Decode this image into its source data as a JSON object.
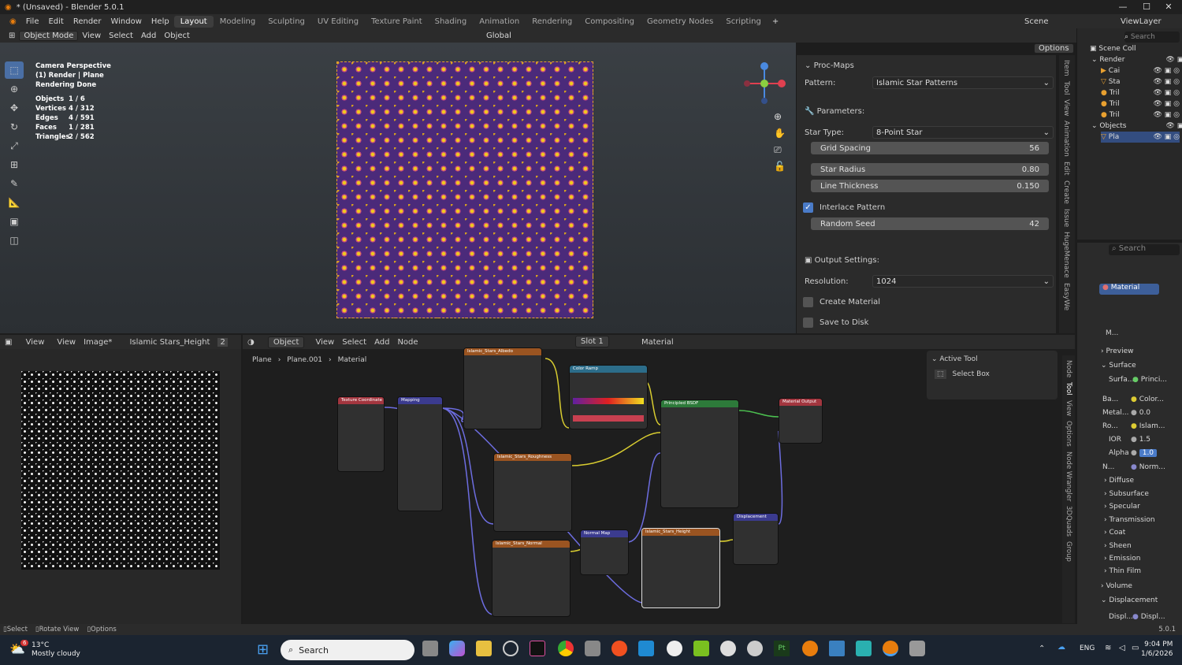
{
  "window": {
    "title": "* (Unsaved) - Blender 5.0.1",
    "min": "—",
    "max": "☐",
    "close": "✕"
  },
  "menu": {
    "items": [
      "File",
      "Edit",
      "Render",
      "Window",
      "Help"
    ],
    "workspaces": [
      "Layout",
      "Modeling",
      "Sculpting",
      "UV Editing",
      "Texture Paint",
      "Shading",
      "Animation",
      "Rendering",
      "Compositing",
      "Geometry Nodes",
      "Scripting"
    ],
    "active": "Layout",
    "add": "+",
    "scene": "Scene",
    "viewlayer": "ViewLayer"
  },
  "viewport_header": {
    "mode": "Object Mode",
    "view": "View",
    "select": "Select",
    "add": "Add",
    "object": "Object",
    "transform": "Global",
    "options": "Options"
  },
  "viewport_info": {
    "line1": "Camera Perspective",
    "line2": "(1) Render | Plane",
    "line3": "Rendering Done",
    "stats": [
      {
        "k": "Objects",
        "v": "1 / 6"
      },
      {
        "k": "Vertices",
        "v": "4 / 312"
      },
      {
        "k": "Edges",
        "v": "4 / 591"
      },
      {
        "k": "Faces",
        "v": "1 / 281"
      },
      {
        "k": "Triangles",
        "v": "2 / 562"
      }
    ]
  },
  "npanel": {
    "title": "Proc-Maps",
    "pattern_label": "Pattern:",
    "pattern": "Islamic Star Patterns",
    "params": "Parameters:",
    "star_type_label": "Star Type:",
    "star_type": "8-Point Star",
    "grid_spacing_label": "Grid Spacing",
    "grid_spacing": "56",
    "star_radius_label": "Star Radius",
    "star_radius": "0.80",
    "line_thickness_label": "Line Thickness",
    "line_thickness": "0.150",
    "interlace": "Interlace Pattern",
    "random_seed_label": "Random Seed",
    "random_seed": "42",
    "output": "Output Settings:",
    "resolution_label": "Resolution:",
    "resolution": "1024",
    "create_material": "Create Material",
    "save_disk": "Save to Disk"
  },
  "side_tabs": [
    "Item",
    "Tool",
    "View",
    "Animation",
    "Edit",
    "Create",
    "Issue",
    "HugeMenace",
    "EasyWe"
  ],
  "outliner": {
    "search": "Search",
    "rows": [
      "Scene Coll",
      "Render",
      "Cai",
      "Sta",
      "Tril",
      "Tril",
      "Tril",
      "Objects",
      "Pla"
    ]
  },
  "properties": {
    "search": "Search",
    "material": "Material",
    "mat_short": "M...",
    "preview": "Preview",
    "surface": "Surface",
    "surface_label": "Surfa...",
    "surface_val": "Princi...",
    "base_label": "Ba...",
    "base_val": "Color...",
    "metal_label": "Metal...",
    "metal_val": "0.0",
    "rough_label": "Ro...",
    "rough_val": "Islam...",
    "ior_label": "IOR",
    "ior_val": "1.5",
    "alpha_label": "Alpha",
    "alpha_val": "1.0",
    "normal_label": "N...",
    "normal_val": "Norm...",
    "sections": [
      "Diffuse",
      "Subsurface",
      "Specular",
      "Transmission",
      "Coat",
      "Sheen",
      "Emission",
      "Thin Film"
    ],
    "volume": "Volume",
    "displacement": "Displacement",
    "disp_label": "Displ...",
    "disp_val": "Displ...",
    "version": "5.0.1"
  },
  "image_editor": {
    "view": "View",
    "view2": "View",
    "image": "Image*",
    "name": "Islamic Stars_Height",
    "users": "2"
  },
  "node_editor": {
    "object": "Object",
    "view": "View",
    "select": "Select",
    "add": "Add",
    "node": "Node",
    "slot": "Slot 1",
    "material": "Material",
    "crumb1": "Plane",
    "crumb2": "Plane.001",
    "crumb3": "Material",
    "active_tool": "Active Tool",
    "select_box": "Select Box",
    "side_tabs": [
      "Node",
      "Tool",
      "View",
      "Options",
      "Node Wrangler",
      "3DQuads",
      "Group"
    ],
    "nodes": [
      {
        "t": "Texture Coordinate",
        "c": "#a3363f"
      },
      {
        "t": "Mapping",
        "c": "#3b3b8f"
      },
      {
        "t": "Islamic_Stars_Albedo",
        "c": "#9a5421"
      },
      {
        "t": "Color Ramp",
        "c": "#2c6d8a"
      },
      {
        "t": "Principled BSDF",
        "c": "#2d7a3a"
      },
      {
        "t": "Material Output",
        "c": "#a3363f"
      },
      {
        "t": "Islamic_Stars_Roughness",
        "c": "#9a5421"
      },
      {
        "t": "Islamic_Stars_Normal",
        "c": "#9a5421"
      },
      {
        "t": "Normal Map",
        "c": "#3b3b8f"
      },
      {
        "t": "Islamic_Stars_Height",
        "c": "#9a5421"
      },
      {
        "t": "Displacement",
        "c": "#3b3b8f"
      }
    ]
  },
  "status": {
    "select": "Select",
    "rotate": "Rotate View",
    "options": "Options"
  },
  "taskbar": {
    "temp": "13°C",
    "weather": "Mostly cloudy",
    "badge": "6",
    "search": "Search",
    "lang": "ENG",
    "time": "9:04 PM",
    "date": "1/6/2026"
  }
}
